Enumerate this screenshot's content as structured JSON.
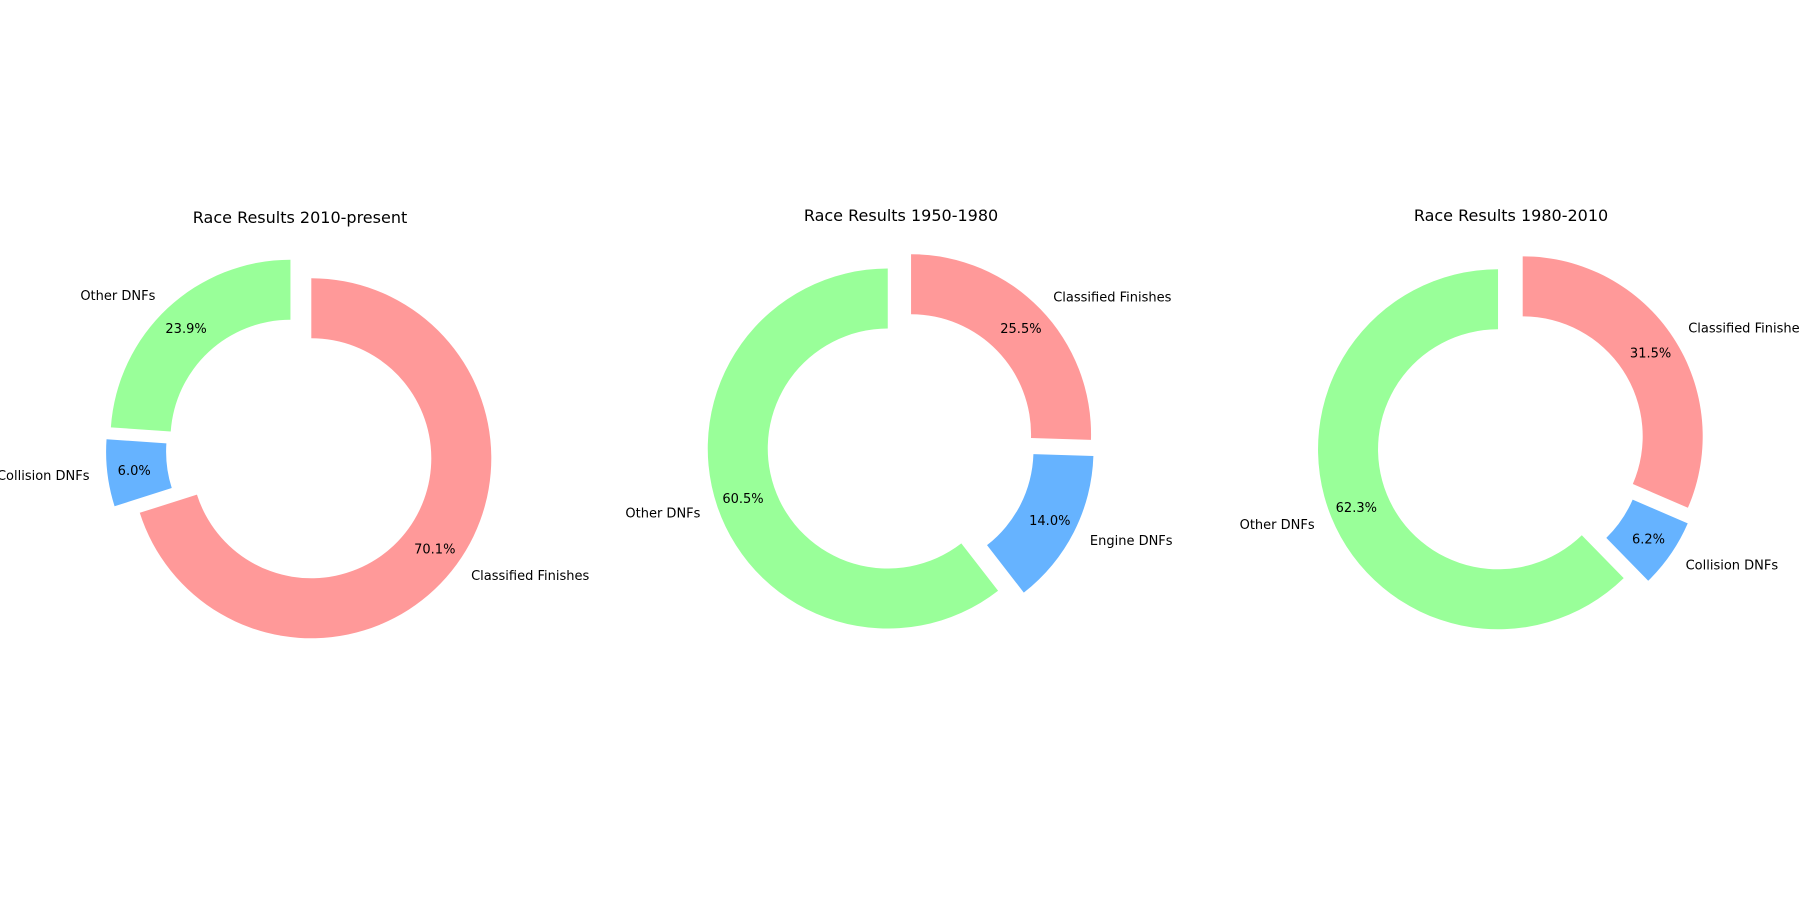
{
  "chart_data": [
    {
      "type": "pie",
      "title": "Race Results 2010-present",
      "slices": [
        {
          "label": "Other DNFs",
          "percent": 23.9,
          "color": "#99ff99"
        },
        {
          "label": "Collision DNFs",
          "percent": 6.0,
          "color": "#66b3ff"
        },
        {
          "label": "Classified Finishes",
          "percent": 70.1,
          "color": "#ff9999"
        }
      ]
    },
    {
      "type": "pie",
      "title": "Race Results 1950-1980",
      "slices": [
        {
          "label": "Other DNFs",
          "percent": 60.5,
          "color": "#99ff99"
        },
        {
          "label": "Engine DNFs",
          "percent": 14.0,
          "color": "#66b3ff"
        },
        {
          "label": "Classified Finishes",
          "percent": 25.5,
          "color": "#ff9999"
        }
      ]
    },
    {
      "type": "pie",
      "title": "Race Results 1980-2010",
      "slices": [
        {
          "label": "Other DNFs",
          "percent": 62.3,
          "color": "#99ff99"
        },
        {
          "label": "Collision DNFs",
          "percent": 6.2,
          "color": "#66b3ff"
        },
        {
          "label": "Classified Finishes",
          "percent": 31.5,
          "color": "#ff9999"
        }
      ]
    }
  ]
}
